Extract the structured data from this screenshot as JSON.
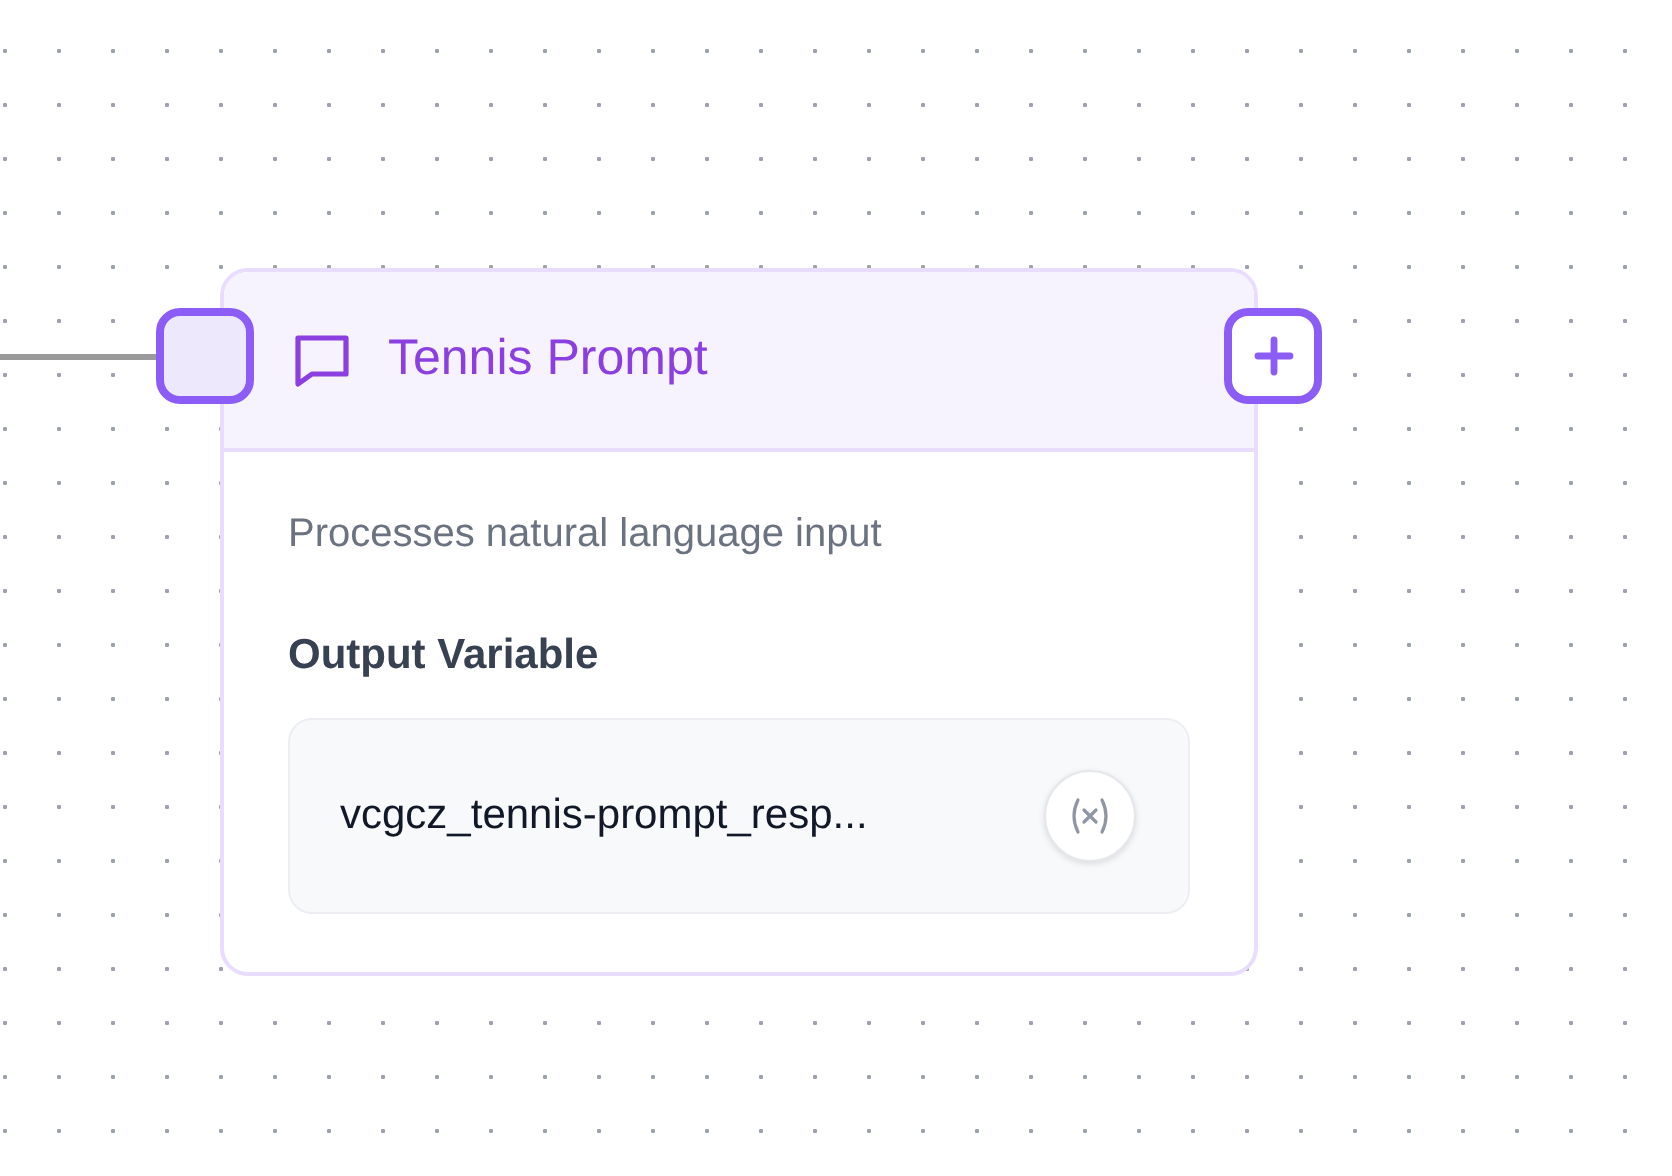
{
  "node": {
    "title": "Tennis Prompt",
    "description": "Processes natural language input",
    "output_label": "Output Variable",
    "output_value": "vcgcz_tennis-prompt_resp..."
  }
}
